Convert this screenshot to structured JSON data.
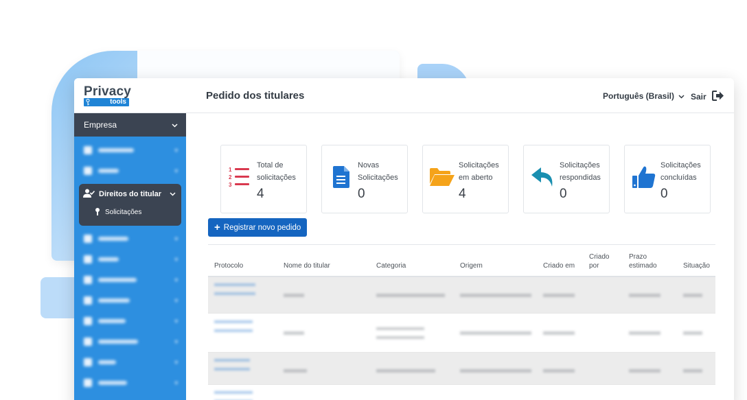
{
  "brand": {
    "name": "Privacy",
    "tagline": "tools"
  },
  "header": {
    "title": "Pedido dos titulares",
    "language": "Português (Brasil)",
    "logout": "Sair"
  },
  "sidebar": {
    "company": "Empresa",
    "section": "Direitos do titular",
    "section_item": "Solicitações"
  },
  "cards": [
    {
      "label": "Total de solicitações",
      "value": "4",
      "icon": "numbered-list-icon",
      "color": "#d9394f"
    },
    {
      "label": "Novas Solicitações",
      "value": "0",
      "icon": "document-icon",
      "color": "#1f74d1"
    },
    {
      "label": "Solicitações em aberto",
      "value": "4",
      "icon": "open-folder-icon",
      "color": "#f5a31a"
    },
    {
      "label": "Solicitações respondidas",
      "value": "0",
      "icon": "reply-arrow-icon",
      "color": "#1a8fb0"
    },
    {
      "label": "Solicitações concluídas",
      "value": "0",
      "icon": "thumbs-up-icon",
      "color": "#1f74d1"
    }
  ],
  "actions": {
    "register": "Registrar novo pedido"
  },
  "table": {
    "columns": [
      "Protocolo",
      "Nome do titular",
      "Categoria",
      "Origem",
      "Criado em",
      "Criado por",
      "Prazo estimado",
      "Situação"
    ]
  }
}
